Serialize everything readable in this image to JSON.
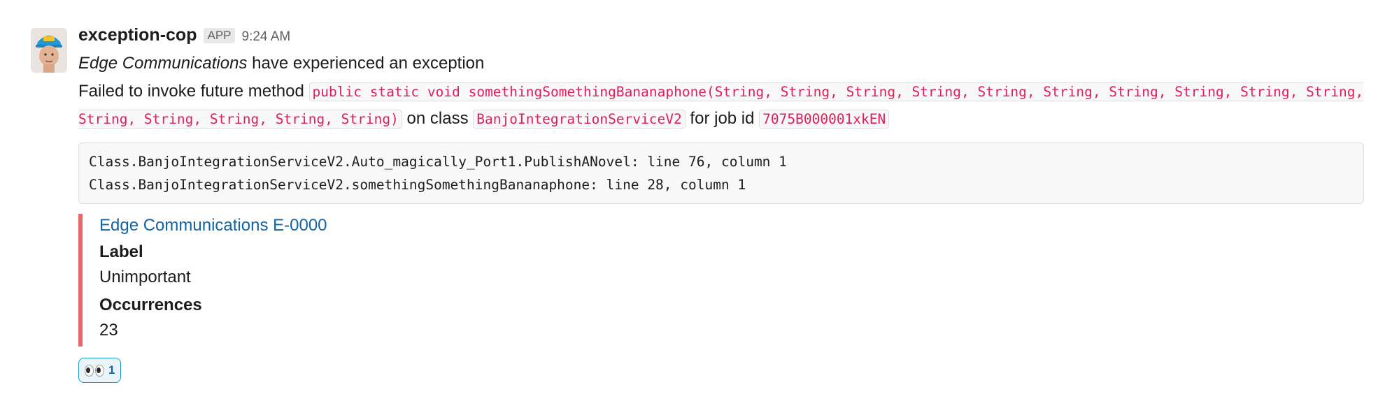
{
  "message": {
    "sender": "exception-cop",
    "badge": "APP",
    "time": "9:24 AM",
    "headline_account": "Edge Communications",
    "headline_rest": " have experienced an exception",
    "body": {
      "prefix": "Failed to invoke future method ",
      "method_signature": "public static void somethingSomethingBananaphone(String, String, String, String, String, String, String, String, String, String, String, String, String, String, String)",
      "on_class_text": " on class ",
      "class_name": "BanjoIntegrationServiceV2",
      "job_text": " for job id ",
      "job_id": "7075B000001xkEN"
    },
    "stack_trace": "Class.BanjoIntegrationServiceV2.Auto_magically_Port1.PublishANovel: line 76, column 1\nClass.BanjoIntegrationServiceV2.somethingSomethingBananaphone: line 28, column 1",
    "attachment": {
      "accent_color": "#e8696b",
      "title": "Edge Communications E-0000",
      "fields": [
        {
          "label": "Label",
          "value": "Unimportant"
        },
        {
          "label": "Occurrences",
          "value": "23"
        }
      ]
    },
    "reaction": {
      "emoji": "eyes-emoji",
      "count": "1"
    }
  },
  "colors": {
    "link": "#1264a3",
    "code_text": "#e01e5a",
    "attachment_border": "#e8696b",
    "reaction_border": "#1d9bd1"
  }
}
